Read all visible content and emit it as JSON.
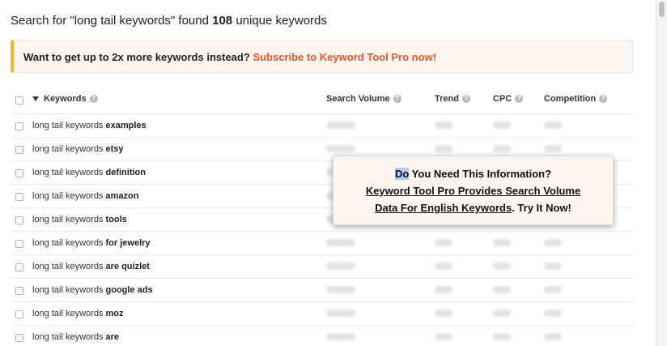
{
  "header": {
    "prefix": "Search for \"long tail keywords\" found ",
    "count": "108",
    "suffix": " unique keywords"
  },
  "upsell": {
    "text": "Want to get up to 2x more keywords instead? ",
    "link": "Subscribe to Keyword Tool Pro now!",
    "accent_color": "#f5b32e",
    "link_color": "#e8562a"
  },
  "table": {
    "columns": {
      "keywords": "Keywords",
      "search_volume": "Search Volume",
      "trend": "Trend",
      "cpc": "CPC",
      "competition": "Competition"
    },
    "help_glyph": "?",
    "rows": [
      {
        "base": "long tail keywords ",
        "suffix": "examples"
      },
      {
        "base": "long tail keywords ",
        "suffix": "etsy"
      },
      {
        "base": "long tail keywords ",
        "suffix": "definition"
      },
      {
        "base": "long tail keywords ",
        "suffix": "amazon"
      },
      {
        "base": "long tail keywords ",
        "suffix": "tools"
      },
      {
        "base": "long tail keywords ",
        "suffix": "for jewelry"
      },
      {
        "base": "long tail keywords ",
        "suffix": "are quizlet"
      },
      {
        "base": "long tail keywords ",
        "suffix": "google ads"
      },
      {
        "base": "long tail keywords ",
        "suffix": "moz"
      },
      {
        "base": "long tail keywords ",
        "suffix": "are"
      }
    ]
  },
  "popup": {
    "selected": "Do",
    "line1_rest": " You Need This Information?",
    "line2_link": "Keyword Tool Pro Provides Search Volume",
    "line3_link": "Data For English Keywords",
    "line3_rest": ". Try It Now!"
  }
}
